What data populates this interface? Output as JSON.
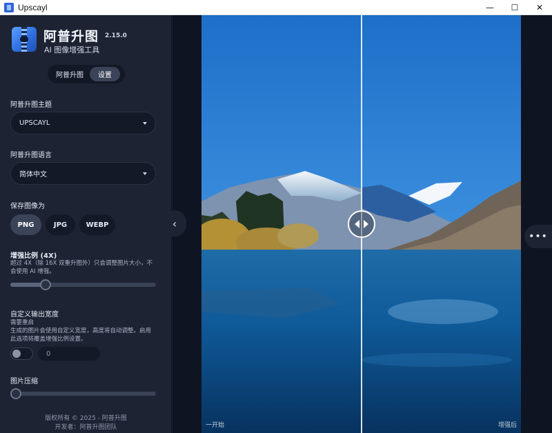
{
  "window": {
    "title": "Upscayl",
    "minimize": "—",
    "maximize": "☐",
    "close": "✕"
  },
  "sidebar": {
    "app_name": "阿普升图",
    "version": "2.15.0",
    "subtitle": "AI 图像增强工具",
    "tabs": [
      "阿普升图",
      "设置"
    ],
    "active_tab": "设置",
    "theme": {
      "label": "阿普升图主题",
      "value": "UPSCAYL"
    },
    "language": {
      "label": "阿普升图语言",
      "value": "简体中文"
    },
    "save_as": {
      "label": "保存图像为",
      "formats": [
        "PNG",
        "JPG",
        "WEBP"
      ],
      "selected": "PNG"
    },
    "scale": {
      "label": "增强比例 (4X)",
      "hint": "超过 4X（除 16X 双重升图外）只会调整图片大小，不会使用 AI 增强。",
      "value_fraction": 0.22
    },
    "custom_width": {
      "label": "自定义输出宽度",
      "hint_title": "需要重启",
      "hint": "生成的图片会使用自定义宽度，高度将自动调整。启用此选项将覆盖增强比例设置。",
      "enabled": false,
      "value": "0"
    },
    "compression": {
      "label": "图片压缩",
      "value_fraction": 0.0
    },
    "footer": {
      "copyright": "版权所有 © 2025 - 阿普升图",
      "developer": "开发者：阿普升图团队"
    }
  },
  "viewer": {
    "left_caption": "一开始",
    "right_caption": "增强后",
    "split_fraction": 0.5
  },
  "icons": {
    "collapse": "‹",
    "more": "•••"
  },
  "colors": {
    "sidebar_bg": "#1d2333",
    "main_bg": "#0f1422",
    "active_pill": "#3a4358"
  }
}
